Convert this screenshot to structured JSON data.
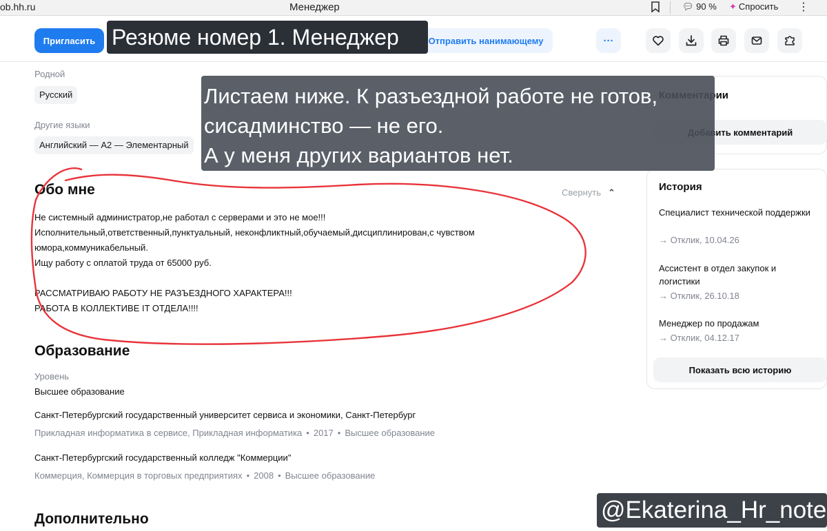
{
  "browser": {
    "url": "ob.hh.ru",
    "tab_title": "Менеджер",
    "zoom": "90 %",
    "ask_label": "Спросить",
    "more": "⋮"
  },
  "toolbar": {
    "invite_label": "Пригласить",
    "send_label": "Отправить нанимающему",
    "more_label": "···"
  },
  "overlays": {
    "title": "Резюме номер 1.  Менеджер",
    "note_lines": [
      "Листаем ниже. К разъездной работе не готов,",
      "сисадминство — не его.",
      "А у меня других вариантов нет."
    ],
    "watermark": "@Ekaterina_Hr_notes"
  },
  "languages": {
    "native_label": "Родной",
    "native_value": "Русский",
    "other_label": "Другие языки",
    "other_value": "Английский — A2 — Элементарный"
  },
  "about": {
    "heading": "Обо мне",
    "collapse_label": "Свернуть",
    "lines": [
      "Не системный администратор,не работал с серверами и это не мое!!!",
      "Исполнительный,ответственный,пунктуальный, неконфликтный,обучаемый,дисциплинирован,с чувством",
      "юмора,коммуникабельный.",
      "Ищу работу с оплатой труда от 65000 руб.",
      "",
      "РАССМАТРИВАЮ РАБОТУ НЕ РАЗЪЕЗДНОГО ХАРАКТЕРА!!!",
      "РАБОТА В КОЛЛЕКТИВЕ IT ОТДЕЛА!!!!"
    ]
  },
  "education": {
    "heading": "Образование",
    "level_label": "Уровень",
    "level_value": "Высшее образование",
    "items": [
      {
        "name": "Санкт-Петербургский государственный университет сервиса и экономики, Санкт-Петербург",
        "specialty": "Прикладная информатика в сервисе, Прикладная информатика",
        "year": "2017",
        "degree": "Высшее образование"
      },
      {
        "name": "Санкт-Петербургский государственный колледж \"Коммерции\"",
        "specialty": "Коммерция, Коммерция в торговых предприятиях",
        "year": "2008",
        "degree": "Высшее образование"
      }
    ]
  },
  "additional": {
    "heading": "Дополнительно"
  },
  "comments": {
    "title": "Комментарии",
    "add_label": "Добавить комментарий"
  },
  "history": {
    "title": "История",
    "items": [
      {
        "title": "Специалист технической поддержки",
        "meta": "→ Отклик, 10.04.26"
      },
      {
        "title": "Ассистент в отдел закупок и логистики",
        "meta": "→ Отклик, 26.10.18"
      },
      {
        "title": "Менеджер по продажам",
        "meta": "→ Отклик, 04.12.17"
      }
    ],
    "show_all_label": "Показать всю историю"
  }
}
